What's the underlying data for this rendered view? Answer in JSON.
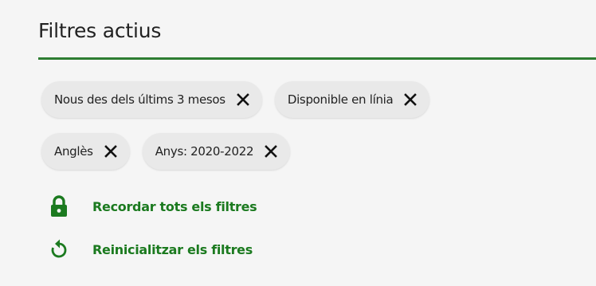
{
  "panel": {
    "title": "Filtres actius"
  },
  "active_filters": [
    {
      "label": "Nous des dels últims 3 mesos",
      "remove_icon": "close-icon"
    },
    {
      "label": "Disponible en línia",
      "remove_icon": "close-icon"
    },
    {
      "label": "Anglès",
      "remove_icon": "close-icon"
    },
    {
      "label": "Anys: 2020-2022",
      "remove_icon": "close-icon"
    }
  ],
  "actions": {
    "remember": {
      "label": "Recordar tots els filtres",
      "icon": "lock-icon"
    },
    "reset": {
      "label": "Reinicialitzar els filtres",
      "icon": "reset-icon"
    }
  },
  "colors": {
    "accent": "#1b7a1f",
    "divider": "#2e7d32",
    "chip_bg": "#e9e9e9",
    "panel_bg": "#f5f5f5"
  }
}
